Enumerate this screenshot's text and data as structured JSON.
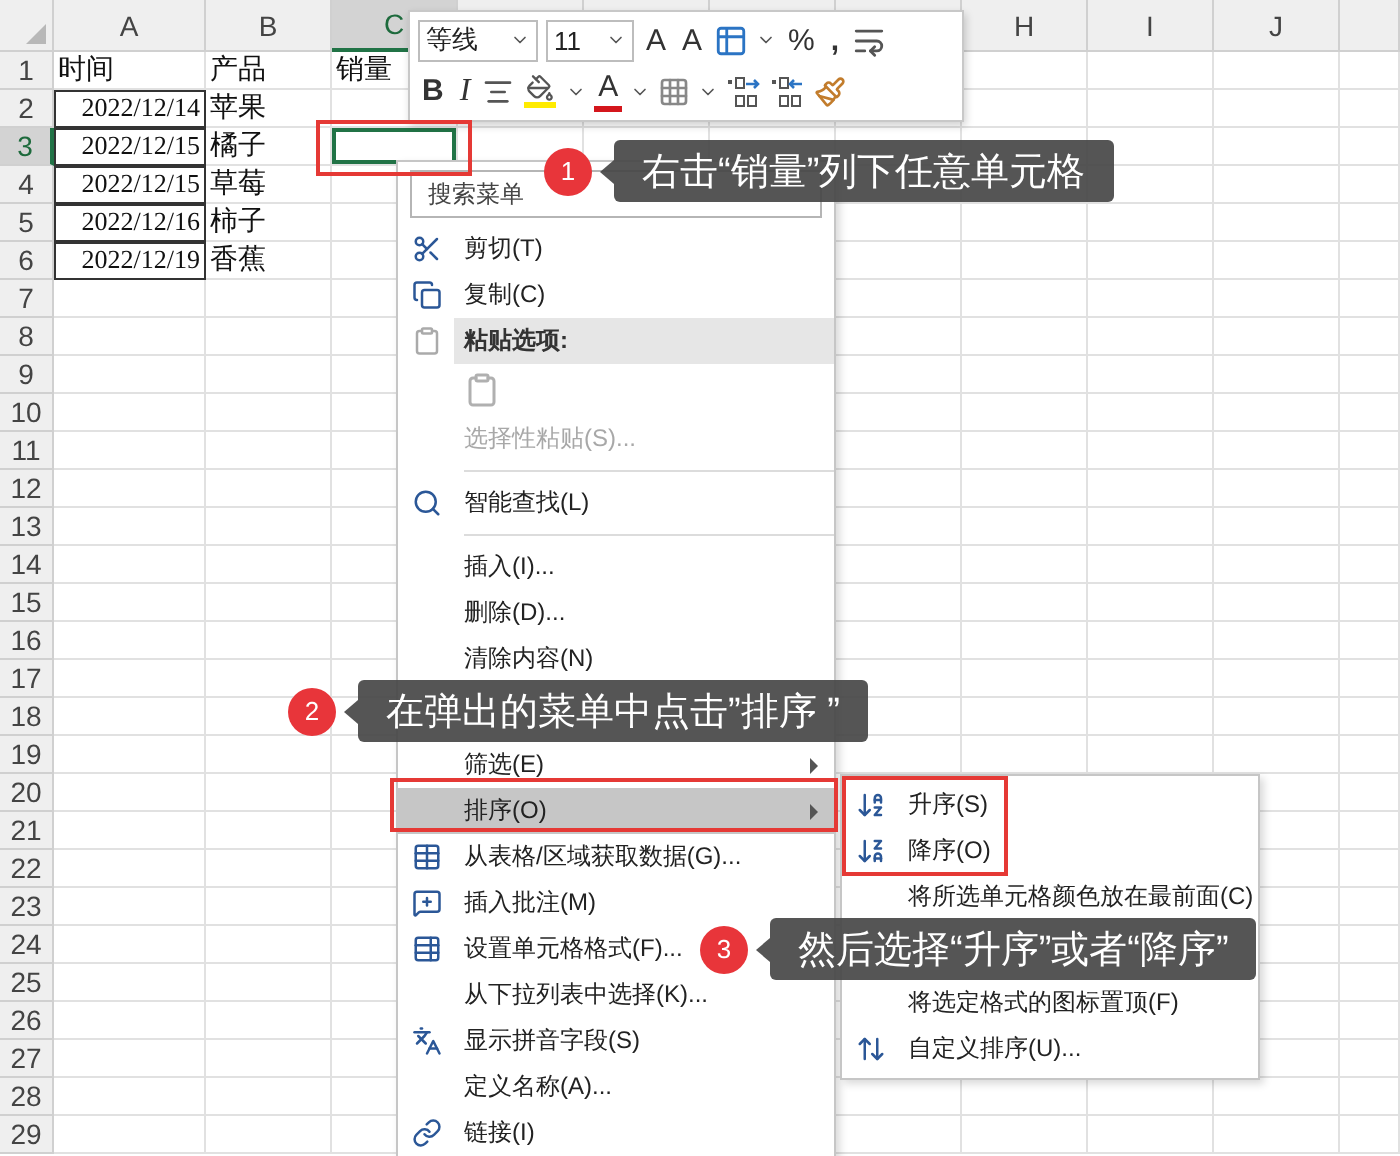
{
  "sheet": {
    "columns": [
      {
        "label": "A",
        "selected": false
      },
      {
        "label": "B",
        "selected": false
      },
      {
        "label": "C",
        "selected": true
      },
      {
        "label": "H",
        "selected": false
      },
      {
        "label": "I",
        "selected": false
      },
      {
        "label": "J",
        "selected": false
      }
    ],
    "rows": [
      {
        "number": "1",
        "selected": false,
        "cells": [
          {
            "kind": "text",
            "text": "时间"
          },
          {
            "kind": "text",
            "text": "产品"
          },
          {
            "kind": "text",
            "text": "销量"
          }
        ]
      },
      {
        "number": "2",
        "selected": false,
        "cells": [
          {
            "kind": "date",
            "text": "2022/12/14"
          },
          {
            "kind": "text",
            "text": "苹果"
          }
        ]
      },
      {
        "number": "3",
        "selected": true,
        "cells": [
          {
            "kind": "date",
            "text": "2022/12/15"
          },
          {
            "kind": "text",
            "text": "橘子"
          }
        ]
      },
      {
        "number": "4",
        "selected": false,
        "cells": [
          {
            "kind": "date",
            "text": "2022/12/15"
          },
          {
            "kind": "text",
            "text": "草莓"
          }
        ]
      },
      {
        "number": "5",
        "selected": false,
        "cells": [
          {
            "kind": "date",
            "text": "2022/12/16"
          },
          {
            "kind": "text",
            "text": "柿子"
          }
        ]
      },
      {
        "number": "6",
        "selected": false,
        "cells": [
          {
            "kind": "date",
            "text": "2022/12/19"
          },
          {
            "kind": "text",
            "text": "香蕉"
          }
        ]
      },
      {
        "number": "7",
        "selected": false
      },
      {
        "number": "8",
        "selected": false
      },
      {
        "number": "9",
        "selected": false
      },
      {
        "number": "10",
        "selected": false
      },
      {
        "number": "11",
        "selected": false
      },
      {
        "number": "12",
        "selected": false
      },
      {
        "number": "13",
        "selected": false
      },
      {
        "number": "14",
        "selected": false
      },
      {
        "number": "15",
        "selected": false
      },
      {
        "number": "16",
        "selected": false
      },
      {
        "number": "17",
        "selected": false
      },
      {
        "number": "18",
        "selected": false
      },
      {
        "number": "19",
        "selected": false
      },
      {
        "number": "20",
        "selected": false
      },
      {
        "number": "21",
        "selected": false
      },
      {
        "number": "22",
        "selected": false
      },
      {
        "number": "23",
        "selected": false
      },
      {
        "number": "24",
        "selected": false
      },
      {
        "number": "25",
        "selected": false
      },
      {
        "number": "26",
        "selected": false
      },
      {
        "number": "27",
        "selected": false
      },
      {
        "number": "28",
        "selected": false
      },
      {
        "number": "29",
        "selected": false
      }
    ]
  },
  "mini_toolbar": {
    "font": "等线",
    "size": "11",
    "grow": "A",
    "shrink": "A",
    "percent": "%",
    "comma": ",",
    "bold": "B",
    "italic": "I",
    "font_color": "A"
  },
  "context_menu": {
    "search_placeholder": "搜索菜单",
    "items": [
      {
        "kind": "item",
        "label": "剪切(T)",
        "selected": false,
        "disabled": false,
        "submenu": false
      },
      {
        "kind": "item",
        "label": "复制(C)",
        "selected": false,
        "disabled": false,
        "submenu": false
      },
      {
        "kind": "header",
        "label": "粘贴选项:"
      },
      {
        "kind": "paste_options"
      },
      {
        "kind": "item",
        "label": "选择性粘贴(S)...",
        "selected": false,
        "disabled": true,
        "submenu": false
      },
      {
        "kind": "separator"
      },
      {
        "kind": "item",
        "label": "智能查找(L)",
        "selected": false,
        "disabled": false,
        "submenu": false
      },
      {
        "kind": "separator"
      },
      {
        "kind": "item",
        "label": "插入(I)...",
        "selected": false,
        "disabled": false,
        "submenu": false
      },
      {
        "kind": "item",
        "label": "删除(D)...",
        "selected": false,
        "disabled": false,
        "submenu": false
      },
      {
        "kind": "item",
        "label": "清除内容(N)",
        "selected": false,
        "disabled": false,
        "submenu": false
      },
      {
        "kind": "covered"
      },
      {
        "kind": "item",
        "label": "筛选(E)",
        "selected": false,
        "disabled": false,
        "submenu": true
      },
      {
        "kind": "item",
        "label": "排序(O)",
        "selected": true,
        "disabled": false,
        "submenu": true
      },
      {
        "kind": "item",
        "label": "从表格/区域获取数据(G)...",
        "selected": false,
        "disabled": false,
        "submenu": false
      },
      {
        "kind": "item",
        "label": "插入批注(M)",
        "selected": false,
        "disabled": false,
        "submenu": false
      },
      {
        "kind": "item",
        "label": "设置单元格格式(F)...",
        "selected": false,
        "disabled": false,
        "submenu": false
      },
      {
        "kind": "item",
        "label": "从下拉列表中选择(K)...",
        "selected": false,
        "disabled": false,
        "submenu": false
      },
      {
        "kind": "item",
        "label": "显示拼音字段(S)",
        "selected": false,
        "disabled": false,
        "submenu": false
      },
      {
        "kind": "item",
        "label": "定义名称(A)...",
        "selected": false,
        "disabled": false,
        "submenu": false
      },
      {
        "kind": "item",
        "label": "链接(I)",
        "selected": false,
        "disabled": false,
        "submenu": false
      }
    ]
  },
  "sort_submenu": {
    "items": [
      {
        "kind": "item",
        "label": "升序(S)"
      },
      {
        "kind": "item",
        "label": "降序(O)"
      },
      {
        "kind": "item",
        "label": "将所选单元格颜色放在最前面(C)"
      },
      {
        "kind": "covered"
      },
      {
        "kind": "item",
        "label": "将选定格式的图标置顶(F)"
      },
      {
        "kind": "item",
        "label": "自定义排序(U)..."
      }
    ]
  },
  "callouts": [
    {
      "number": "1",
      "text": "右击“销量”列下任意单元格"
    },
    {
      "number": "2",
      "text": "在弹出的菜单中点击”排序 ”"
    },
    {
      "number": "3",
      "text": "然后选择“升序”或者“降序”"
    }
  ]
}
